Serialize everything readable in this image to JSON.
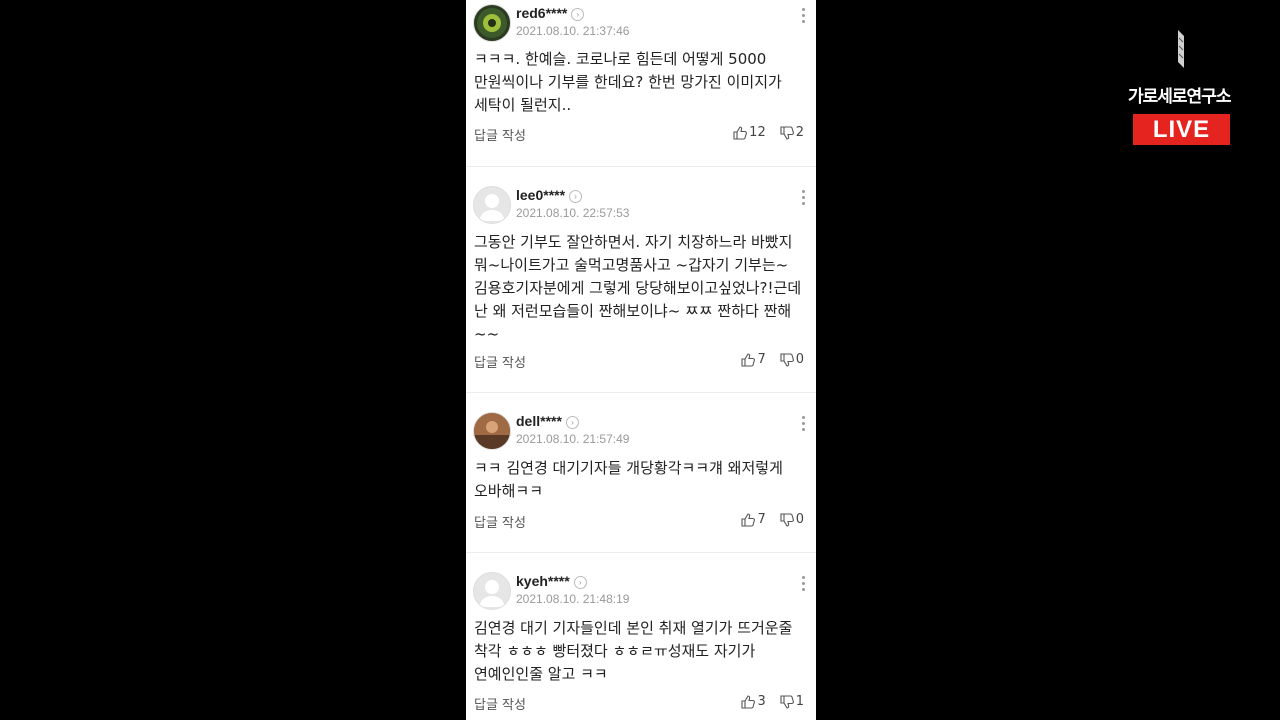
{
  "brand": {
    "logo_text": "가로세로연구소",
    "live_label": "LIVE",
    "live_color": "#e52420"
  },
  "ui": {
    "reply_label": "답글 작성",
    "profile_icon": "chevron-right-icon",
    "more_icon": "more-vertical-icon",
    "like_icon": "thumbs-up-icon",
    "dislike_icon": "thumbs-down-icon"
  },
  "comments": [
    {
      "username": "red6****",
      "date": "2021.08.10. 21:37:46",
      "text": "ㅋㅋㅋ. 한예슬. 코로나로 힘든데 어떻게 5000 만원씩이나 기부를 한데요? 한번 망가진 이미지가 세탁이 될런지..",
      "likes": "12",
      "dislikes": "2"
    },
    {
      "username": "lee0****",
      "date": "2021.08.10. 22:57:53",
      "text": "그동안 기부도 잘안하면서. 자기 치장하느라 바빴지 뭐~나이트가고 술먹고명품사고 ~갑자기 기부는~김용호기자분에게 그렇게 당당해보이고싶었나?!근데 난 왜 저런모습들이 짠해보이냐~ ㅉㅉ 짠하다 짠해~~",
      "likes": "7",
      "dislikes": "0"
    },
    {
      "username": "dell****",
      "date": "2021.08.10. 21:57:49",
      "text": "ㅋㅋ 김연경 대기기자들 개당황각ㅋㅋ걔 왜저렇게 오바해ㅋㅋ",
      "likes": "7",
      "dislikes": "0"
    },
    {
      "username": "kyeh****",
      "date": "2021.08.10. 21:48:19",
      "text": "김연경 대기 기자들인데 본인 취재 열기가 뜨거운줄 착각 ㅎㅎㅎ 빵터졌다 ㅎㅎㄹㅠ성재도 자기가 연예인인줄 알고 ㅋㅋ",
      "likes": "3",
      "dislikes": "1"
    }
  ]
}
